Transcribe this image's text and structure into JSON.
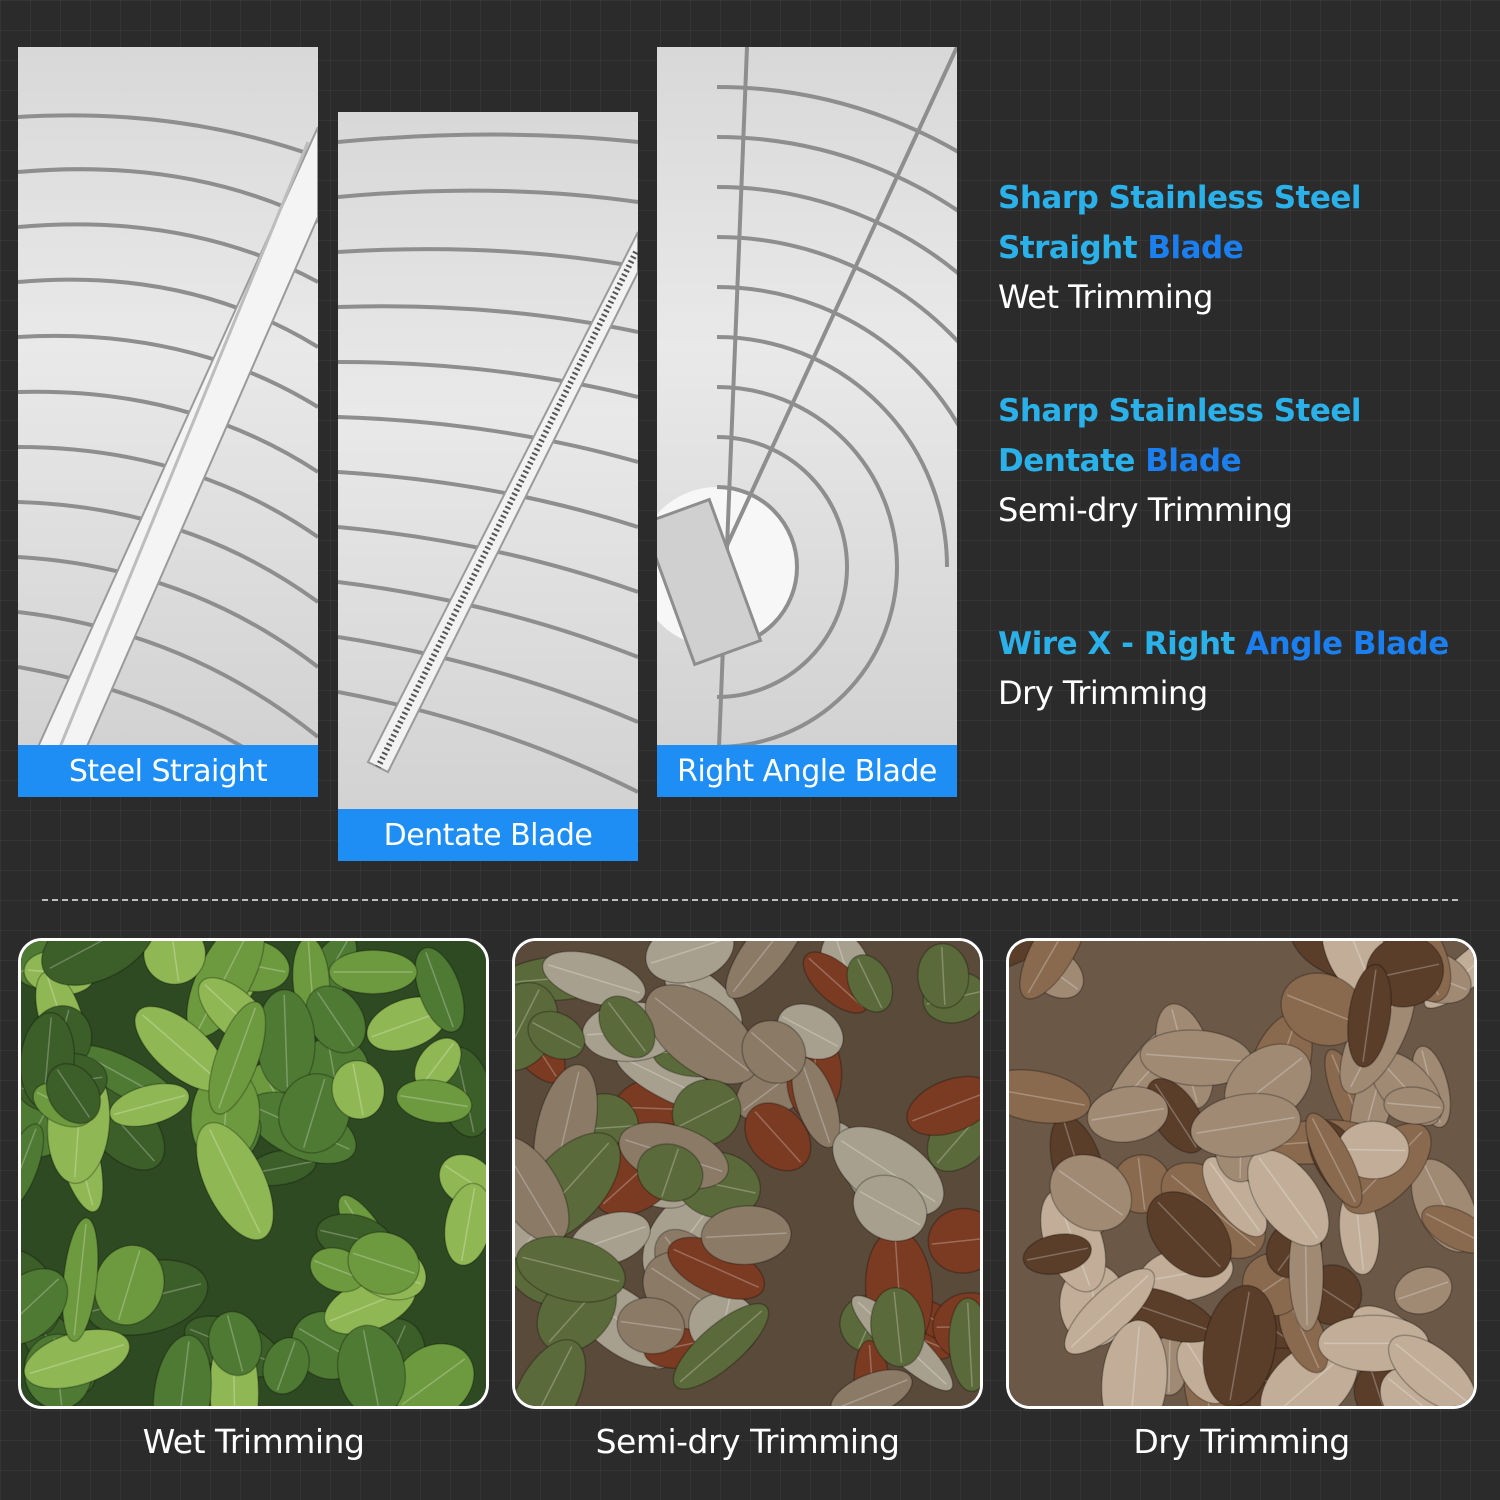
{
  "blades": [
    {
      "label": "Steel Straight"
    },
    {
      "label": "Dentate Blade"
    },
    {
      "label": "Right Angle Blade"
    }
  ],
  "specs": [
    {
      "title_line1": "Sharp Stainless Steel",
      "title_line2_a": "Straight ",
      "title_line2_b": "Blade",
      "subtitle": "Wet Trimming"
    },
    {
      "title_line1": "Sharp Stainless Steel",
      "title_line2_a": "Dentate ",
      "title_line2_b": "Blade",
      "subtitle": "Semi-dry Trimming"
    },
    {
      "title_line1_a": "Wire X - Right ",
      "title_line1_b": "Angle Blade",
      "subtitle": "Dry Trimming"
    }
  ],
  "leaves": [
    {
      "caption": "Wet Trimming",
      "palette": [
        "#2e4a22",
        "#4f7a33",
        "#6d9a3e",
        "#8fb854",
        "#3c5e28"
      ]
    },
    {
      "caption": "Semi-dry Trimming",
      "palette": [
        "#5a4a3a",
        "#8a7a66",
        "#7a3b22",
        "#5b6a3a",
        "#a8a08f"
      ]
    },
    {
      "caption": "Dry Trimming",
      "palette": [
        "#6b5847",
        "#a08a74",
        "#8a6a4e",
        "#c2ae98",
        "#5a3e2a"
      ]
    }
  ],
  "colors": {
    "background": "#2b2b2b",
    "label_blue": "#1e8ef5",
    "title_cyan": "#2ab1ea",
    "title_blue": "#1b7ff0"
  }
}
